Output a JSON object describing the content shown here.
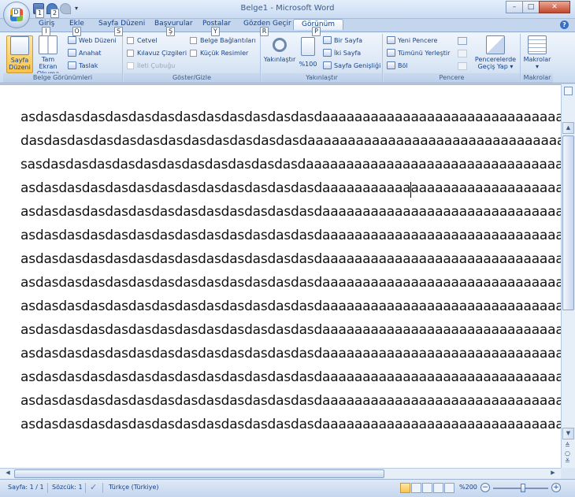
{
  "window": {
    "title": "Belge1 - Microsoft Word",
    "minimize": "–",
    "maximize": "□",
    "close": "✕"
  },
  "tabs": [
    {
      "label": "Giriş",
      "key": "I"
    },
    {
      "label": "Ekle",
      "key": "O"
    },
    {
      "label": "Sayfa Düzeni",
      "key": "S"
    },
    {
      "label": "Başvurular",
      "key": "Ş"
    },
    {
      "label": "Postalar",
      "key": "Y"
    },
    {
      "label": "Gözden Geçir",
      "key": "R"
    },
    {
      "label": "Görünüm",
      "key": "P"
    }
  ],
  "qat_keys": [
    "1",
    "2"
  ],
  "office_key": "D",
  "ribbon": {
    "belge_gorunumleri": {
      "label": "Belge Görünümleri",
      "sayfa_duzeni": "Sayfa Düzeni",
      "tam_ekran": "Tam Ekran Okuma",
      "web_duzeni": "Web Düzeni",
      "anahat": "Anahat",
      "taslak": "Taslak"
    },
    "goster_gizle": {
      "label": "Göster/Gizle",
      "cetvel": "Cetvel",
      "kilavuz": "Kılavuz Çizgileri",
      "ileti": "İleti Çubuğu",
      "belge_baglantilari": "Belge Bağlantıları",
      "kucuk_resimler": "Küçük Resimler"
    },
    "yakinlastir": {
      "label": "Yakınlaştır",
      "yakinlastir_btn": "Yakınlaştır",
      "yuzde100": "%100",
      "bir_sayfa": "Bir Sayfa",
      "iki_sayfa": "İki Sayfa",
      "sayfa_genisligi": "Sayfa Genişliği"
    },
    "pencere": {
      "label": "Pencere",
      "yeni_pencere": "Yeni Pencere",
      "tumunu_yerlestir": "Tümünü Yerleştir",
      "bol": "Böl",
      "gecis_yap": "Pencerelerde Geçiş Yap ▾"
    },
    "makrolar": {
      "label": "Makrolar",
      "makrolar_btn": "Makrolar"
    }
  },
  "document": {
    "lines": [
      "asdasdasdasdasdasdasdasdasdasdasdasdasdaaaaaaaaaaaaaaaaaaaaaaaaaaaaaaaa",
      "dasdasdasdasdasdasdasdasdasdasdasdasdaaaaaaaaaaaaaaaaaaaaaaaaaaaaaaaaa",
      "sasdasdasdasdasdasdasdasdasdasdasdasdaaaaaaaaaaaaaaaaaaaaaaaaaaaaaaaaa",
      "asdasdasdasdasdasdasdasdasdasdasdasdasdaaaaaaaaaaaaaaaaaaaaaaaaaaaaaaaa",
      "asdasdasdasdasdasdasdasdasdasdasdasdasdaaaaaaaaaaaaaaaaaaaaaaaaaaaaaaaa",
      "asdasdasdasdasdasdasdasdasdasdasdasdasdaaaaaaaaaaaaaaaaaaaaaaaaaaaaaaaa",
      "asdasdasdasdasdasdasdasdasdasdasdasdasdaaaaaaaaaaaaaaaaaaaaaaaaaaaaaaaa",
      "asdasdasdasdasdasdasdasdasdasdasdasdasdaaaaaaaaaaaaaaaaaaaaaaaaaaaaaaaa",
      "asdasdasdasdasdasdasdasdasdasdasdasdasdaaaaaaaaaaaaaaaaaaaaaaaaaaaaaaaa",
      "asdasdasdasdasdasdasdasdasdasdasdasdasdaaaaaaaaaaaaaaaaaaaaaaaaaaaaaaaa",
      "asdasdasdasdasdasdasdasdasdasdasdasdasdaaaaaaaaaaaaaaaaaaaaaaaaaaaaaaaa",
      "asdasdasdasdasdasdasdasdasdasdasdasdasdaaaaaaaaaaaaaaaaaaaaaaaaaaaaaaaa",
      "asdasdasdasdasdasdasdasdasdasdasdasdasdaaaaaaaaaaaaaaaaaaaaaaaaaaaaaaaa",
      "asdasdasdasdasdasdasdasdasdasdasdasdasdaaaaaaaaaaaaaaaaaaaaaaaaaaaaaaaa"
    ]
  },
  "statusbar": {
    "sayfa": "Sayfa: 1 / 1",
    "sozcuk": "Sözcük: 1",
    "dil": "Türkçe (Türkiye)",
    "zoom": "%200",
    "zoom_minus": "−",
    "zoom_plus": "+"
  },
  "icons": {
    "office": "office-logo",
    "scroll_up": "▲",
    "scroll_down": "▼",
    "scroll_left": "◀",
    "scroll_right": "▶",
    "browse_prev": "≜",
    "browse_obj": "○",
    "browse_next": "≚"
  }
}
